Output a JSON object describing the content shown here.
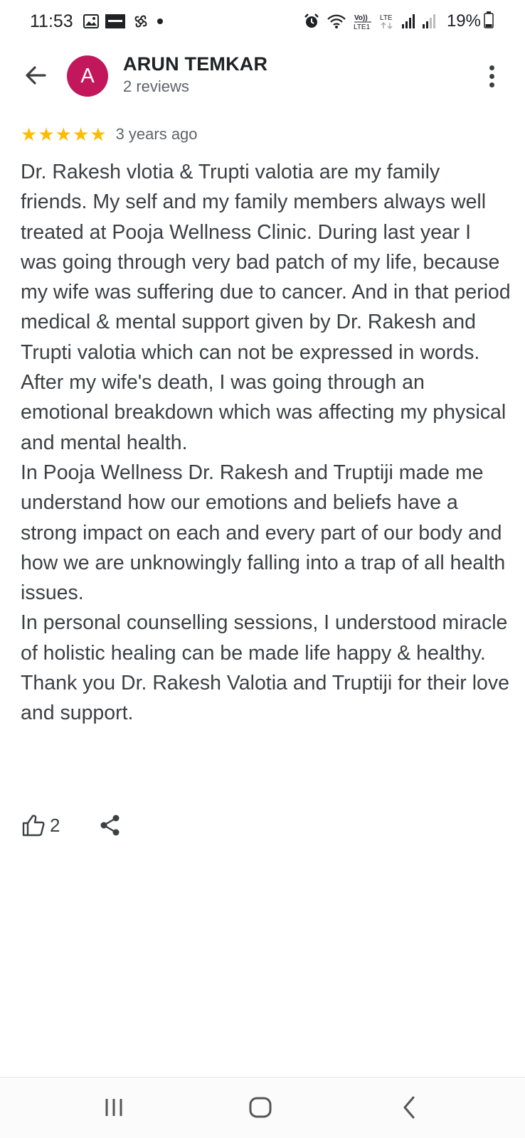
{
  "status_bar": {
    "time": "11:53",
    "network": "Vo) LTE1",
    "battery": "19%",
    "icons": [
      "gallery-icon",
      "app-badge-icon",
      "fan-icon",
      "dot-icon",
      "alarm-icon",
      "wifi-icon",
      "volte-icon",
      "lte-icon",
      "signal-icon",
      "signal-weak-icon",
      "battery-icon"
    ]
  },
  "header": {
    "avatar_letter": "A",
    "avatar_color": "#c2185b",
    "name": "ARUN TEMKAR",
    "reviews": "2 reviews"
  },
  "review": {
    "stars": 5,
    "star_color": "#fbbc04",
    "date": "3 years ago",
    "paragraphs": [
      "Dr. Rakesh vlotia & Trupti valotia are my family friends. My self and my family members always well treated at Pooja Wellness Clinic. During last year I was going through very bad patch of my life, because my wife was suffering due to cancer. And in that period medical & mental support given by Dr. Rakesh and Trupti valotia which can not be expressed in words. After my wife's death, I was going through an emotional breakdown which was affecting my physical and mental health.",
      "In Pooja Wellness Dr. Rakesh and Truptiji made me understand how our emotions and beliefs have a strong impact on each and every part of our body and how we are unknowingly falling into a trap of all health issues.",
      "In personal counselling sessions, I understood miracle of holistic healing can be made life happy & healthy.",
      "Thank you Dr. Rakesh Valotia and Truptiji for their love and support."
    ]
  },
  "actions": {
    "like_count": "2"
  },
  "nav": {
    "buttons": [
      "recent-apps",
      "home",
      "back"
    ]
  }
}
